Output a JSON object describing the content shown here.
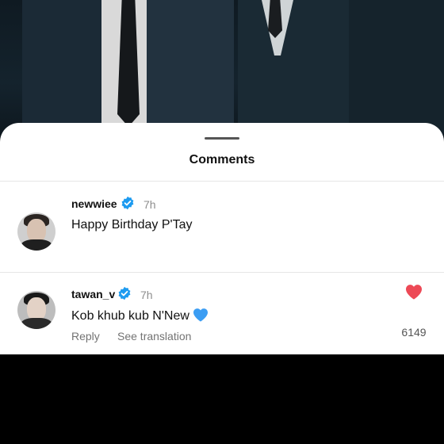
{
  "sheet": {
    "title": "Comments"
  },
  "comments": [
    {
      "username": "newwiee",
      "verified": true,
      "time": "7h",
      "text": "Happy Birthday P'Tay"
    },
    {
      "username": "tawan_v",
      "verified": true,
      "time": "7h",
      "text": "Kob khub kub N'New",
      "emoji": "blue-heart",
      "reply_label": "Reply",
      "translate_label": "See translation",
      "likes": "6149",
      "liked": true
    }
  ],
  "colors": {
    "verified_blue": "#1d9bf0",
    "like_red": "#ed4956",
    "emoji_blue": "#3b9df3"
  }
}
